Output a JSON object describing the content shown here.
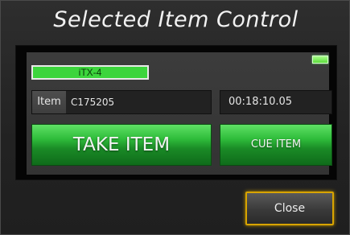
{
  "dialog": {
    "title": "Selected Item Control",
    "close_label": "Close"
  },
  "panel": {
    "device_name": "iTX-4",
    "status_indicator_color": "#5cdc3c",
    "item_label": "Item",
    "item_value": "C175205",
    "timecode": "00:18:10.05",
    "take_label": "TAKE ITEM",
    "cue_label": "CUE ITEM"
  },
  "colors": {
    "accent_green": "#2fbd3b",
    "focus_border": "#d8a400",
    "background": "#1c1c1c"
  }
}
